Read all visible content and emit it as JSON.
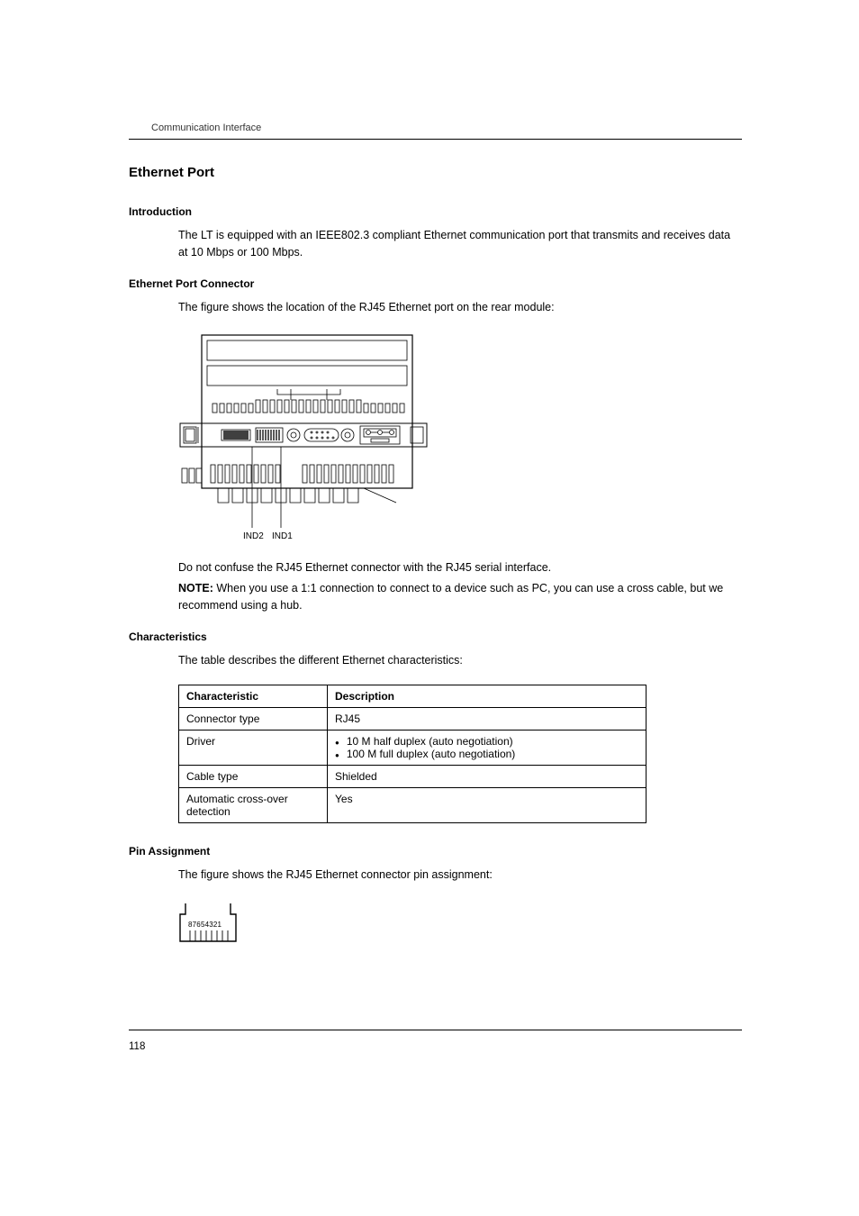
{
  "header": "Communication Interface",
  "title": "Ethernet Port",
  "sections": {
    "intro": {
      "heading": "Introduction",
      "text": "The LT is equipped with an IEEE802.3 compliant Ethernet communication port that transmits and receives data at 10 Mbps or 100 Mbps."
    },
    "connector": {
      "heading": "Ethernet Port Connector",
      "text1": "The figure shows the location of the RJ45 Ethernet port on the rear module:",
      "label_ind2": "IND2",
      "label_ind1": "IND1",
      "text2": "Do not confuse the RJ45 Ethernet connector with the RJ45 serial interface.",
      "note_label": "NOTE:",
      "note_text": " When you use a 1:1 connection to connect to a device such as PC, you can use a cross cable, but we recommend using a hub."
    },
    "characteristics": {
      "heading": "Characteristics",
      "text": "The table describes the different Ethernet characteristics:",
      "table": {
        "head_char": "Characteristic",
        "head_desc": "Description",
        "rows": [
          {
            "char": "Connector type",
            "desc_simple": "RJ45"
          },
          {
            "char": "Driver",
            "desc_list": [
              "10 M half duplex (auto negotiation)",
              "100 M full duplex (auto negotiation)"
            ]
          },
          {
            "char": "Cable type",
            "desc_simple": "Shielded"
          },
          {
            "char": "Automatic cross-over detection",
            "desc_simple": "Yes"
          }
        ]
      }
    },
    "pin": {
      "heading": "Pin Assignment",
      "text": "The figure shows the RJ45 Ethernet connector pin assignment:",
      "pins": "87654321"
    }
  },
  "page_number": "118"
}
